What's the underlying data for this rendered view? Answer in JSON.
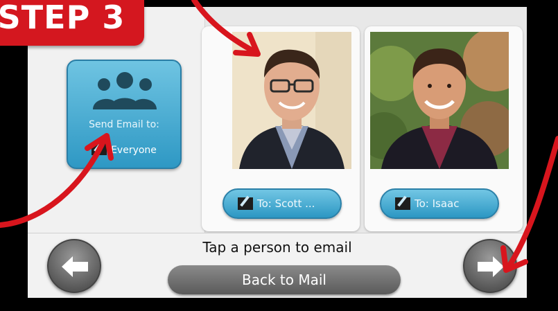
{
  "step_badge": "STEP 3",
  "group_tile": {
    "icon": "people-group-icon",
    "label": "Send Email to:",
    "value": "Everyone",
    "edit_icon": "edit-icon"
  },
  "people": [
    {
      "button_label": "To: Scott ...",
      "photo": "man-in-glasses-suit-photo"
    },
    {
      "button_label": "To: Isaac",
      "photo": "young-man-dark-jacket-photo"
    }
  ],
  "bottom": {
    "prompt": "Tap a person to email",
    "back_label": "Back to Mail",
    "prev_icon": "arrow-left-icon",
    "next_icon": "arrow-right-icon"
  },
  "colors": {
    "badge_red": "#d4171f",
    "tile_blue": "#3ba6cf",
    "nav_gray": "#6e6e6e",
    "annotation_red": "#d8151d"
  }
}
